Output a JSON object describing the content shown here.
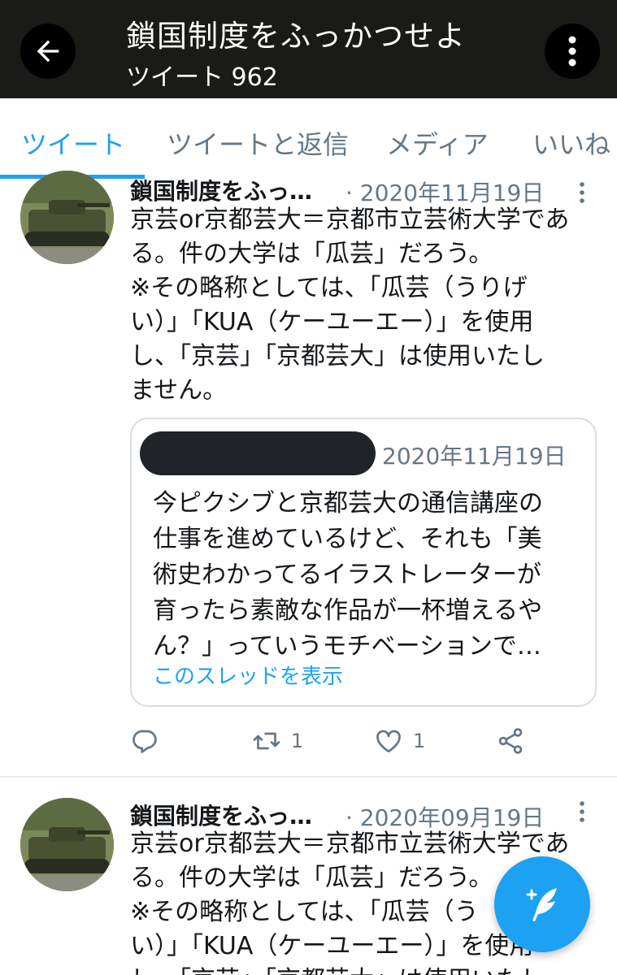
{
  "header": {
    "title": "鎖国制度をふっかつせよ",
    "subtitle": "ツイート 962",
    "back_icon": "arrow-left-icon",
    "more_icon": "more-vertical-icon",
    "bg_color": "#1a1a16"
  },
  "tabs": [
    {
      "label": "ツイート",
      "active": true
    },
    {
      "label": "ツイートと返信",
      "active": false
    },
    {
      "label": "メディア",
      "active": false
    },
    {
      "label": "いいね",
      "active": false
    }
  ],
  "tweets": [
    {
      "name": "鎖国制度をふっ…",
      "date": "· 2020年11月19日",
      "text_lines": [
        "京芸or京都芸大＝京都市立芸術大学であ",
        "る。件の大学は「瓜芸」だろう。",
        "※その略称としては、「瓜芸（うりげ",
        "い）」「KUA（ケーユーエー）」を使用",
        "し、「京芸」「京都芸大」は使用いたし",
        "ません。"
      ],
      "quote": {
        "date": "2020年11月19日",
        "text_lines": [
          "今ピクシブと京都芸大の通信講座の",
          "仕事を進めているけど、それも「美",
          "術史わかってるイラストレーターが",
          "育ったら素敵な作品が一杯増えるや",
          "ん？」っていうモチベーションで…"
        ],
        "link": "このスレッドを表示"
      },
      "actions": {
        "reply_count": "",
        "retweet_count": "1",
        "like_count": "1"
      }
    },
    {
      "name": "鎖国制度をふっ…",
      "date": "· 2020年09月19日",
      "text_lines": [
        "京芸or京都芸大＝京都市立芸術大学であ",
        "る。件の大学は「瓜芸」だろう。",
        "※その略称としては、「瓜芸（う",
        "い）」「KUA（ケーユーエー）」を使用",
        "し、「京芸」「京都芸大」は使用いたし"
      ]
    }
  ],
  "fab": {
    "icon": "compose-tweet-icon",
    "color": "#1da1f2"
  },
  "colors": {
    "accent": "#1da1f2",
    "secondary_text": "#657786"
  }
}
